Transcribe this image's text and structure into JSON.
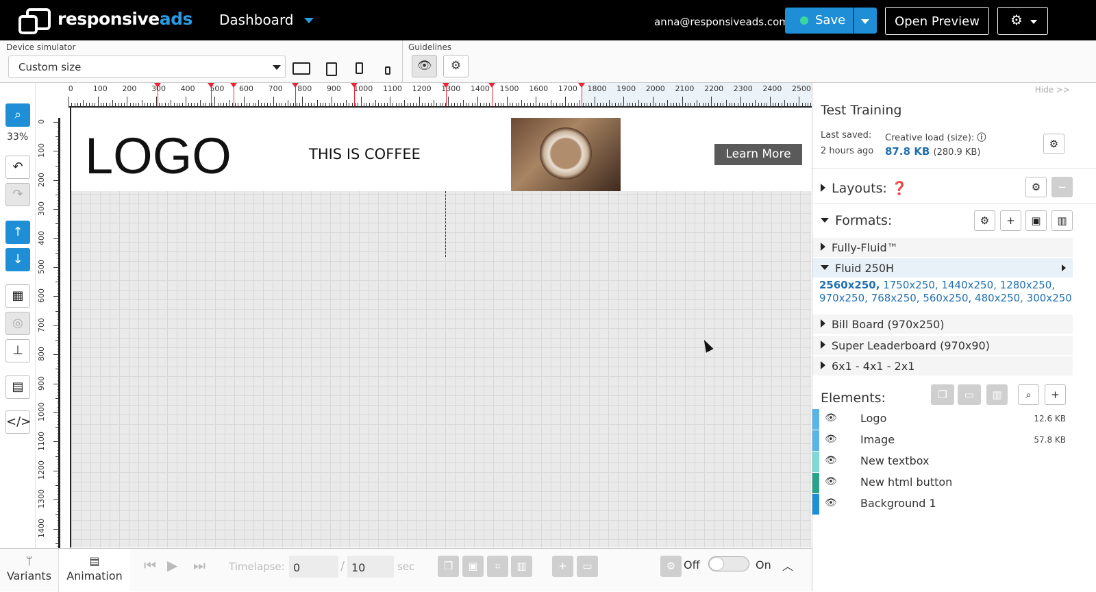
{
  "header": {
    "brand_main": "responsive",
    "brand_accent": "ads",
    "dashboard_label": "Dashboard",
    "user_email": "anna@responsiveads.com",
    "save_label": "Save",
    "preview_label": "Open Preview"
  },
  "toolbar": {
    "device_label": "Device simulator",
    "device_value": "Custom size",
    "guidelines_label": "Guidelines"
  },
  "left_tools": {
    "zoom": "33%"
  },
  "ruler": {
    "h_labels": [
      "0",
      "100",
      "200",
      "300",
      "400",
      "500",
      "600",
      "700",
      "800",
      "900",
      "1000",
      "1100",
      "1200",
      "1300",
      "1400",
      "1500",
      "1600",
      "1700",
      "1800",
      "1900",
      "2000",
      "2100",
      "2200",
      "2300",
      "2400",
      "2500"
    ],
    "v_labels": [
      "0",
      "100",
      "200",
      "300",
      "400",
      "500",
      "600",
      "700",
      "800",
      "900",
      "1000",
      "1100",
      "1200",
      "1300",
      "1400"
    ]
  },
  "banner": {
    "logo": "LOGO",
    "headline": "THIS IS COFFEE",
    "cta": "Learn More"
  },
  "bottom": {
    "variants": "Variants",
    "animation": "Animation",
    "timelapse_label": "Timelapse:",
    "time_current": "0",
    "time_sep": "/",
    "time_total": "10",
    "time_unit": "sec",
    "off": "Off",
    "on": "On"
  },
  "panel": {
    "hide": "Hide >>",
    "title": "Test Training",
    "last_saved_label": "Last saved:",
    "last_saved_value": "2 hours ago",
    "load_label": "Creative load (size):",
    "load_value": "87.8 KB",
    "load_total": "(280.9 KB)",
    "layouts": "Layouts:",
    "formats": "Formats:",
    "format_items": [
      "Fully-Fluid™",
      "Fluid 250H",
      "Bill Board (970x250)",
      "Super Leaderboard (970x90)",
      "6x1 - 4x1 - 2x1"
    ],
    "fluid_selected_size": "2560x250,",
    "fluid_sizes": "1750x250, 1440x250, 1280x250, 970x250, 768x250, 560x250, 480x250, 300x250",
    "elements": "Elements:",
    "element_items": [
      {
        "name": "Logo",
        "size": "12.6 KB",
        "color": "#5ab4e8"
      },
      {
        "name": "Image",
        "size": "57.8 KB",
        "color": "#5ab4e8"
      },
      {
        "name": "New textbox",
        "size": "",
        "color": "#7fd9d2"
      },
      {
        "name": "New html button",
        "size": "",
        "color": "#2aa18a"
      },
      {
        "name": "Background 1",
        "size": "",
        "color": "#1e8fd6"
      }
    ]
  },
  "colors": {
    "accent": "#1e8fd6",
    "brand": "#2a9be3"
  }
}
